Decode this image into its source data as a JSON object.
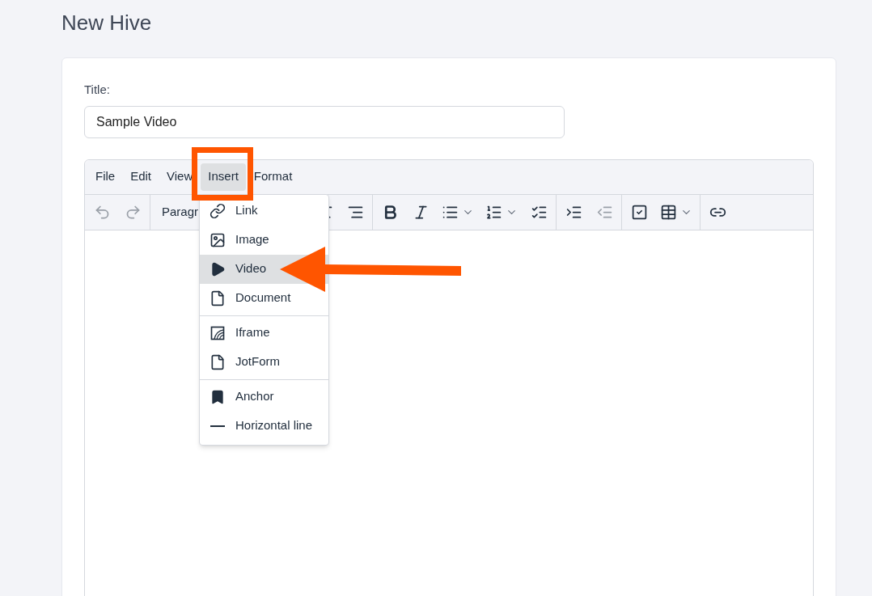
{
  "page": {
    "title": "New Hive"
  },
  "form": {
    "title_label": "Title:",
    "title_value": "Sample Video"
  },
  "editor": {
    "menubar": [
      {
        "label": "File",
        "selected": false
      },
      {
        "label": "Edit",
        "selected": false
      },
      {
        "label": "View",
        "selected": false
      },
      {
        "label": "Insert",
        "selected": true
      },
      {
        "label": "Format",
        "selected": false
      }
    ],
    "toolbar": [
      [
        {
          "kind": "icon",
          "disabled": true
        },
        {
          "kind": "icon",
          "disabled": true
        }
      ],
      [
        {
          "kind": "select",
          "label": "Paragr"
        },
        {
          "kind": "icon",
          "disabled": false
        },
        {
          "kind": "icon",
          "disabled": false
        }
      ],
      [
        {
          "kind": "icon",
          "disabled": false
        },
        {
          "kind": "icon",
          "disabled": false
        },
        {
          "kind": "split",
          "disabled": false
        },
        {
          "kind": "split",
          "disabled": false
        },
        {
          "kind": "icon",
          "disabled": false
        }
      ],
      [
        {
          "kind": "icon",
          "disabled": false
        },
        {
          "kind": "icon",
          "disabled": true
        }
      ],
      [
        {
          "kind": "icon",
          "disabled": false
        },
        {
          "kind": "split",
          "disabled": false
        }
      ],
      [
        {
          "kind": "icon",
          "disabled": false
        }
      ]
    ],
    "insert_menu": [
      [
        {
          "label": "Link",
          "selected": false
        },
        {
          "label": "Image",
          "selected": false
        },
        {
          "label": "Video",
          "selected": true
        },
        {
          "label": "Document",
          "selected": false
        }
      ],
      [
        {
          "label": "Iframe",
          "selected": false
        },
        {
          "label": "JotForm",
          "selected": false
        }
      ],
      [
        {
          "label": "Anchor",
          "selected": false
        },
        {
          "label": "Horizontal line",
          "selected": false
        }
      ]
    ]
  }
}
